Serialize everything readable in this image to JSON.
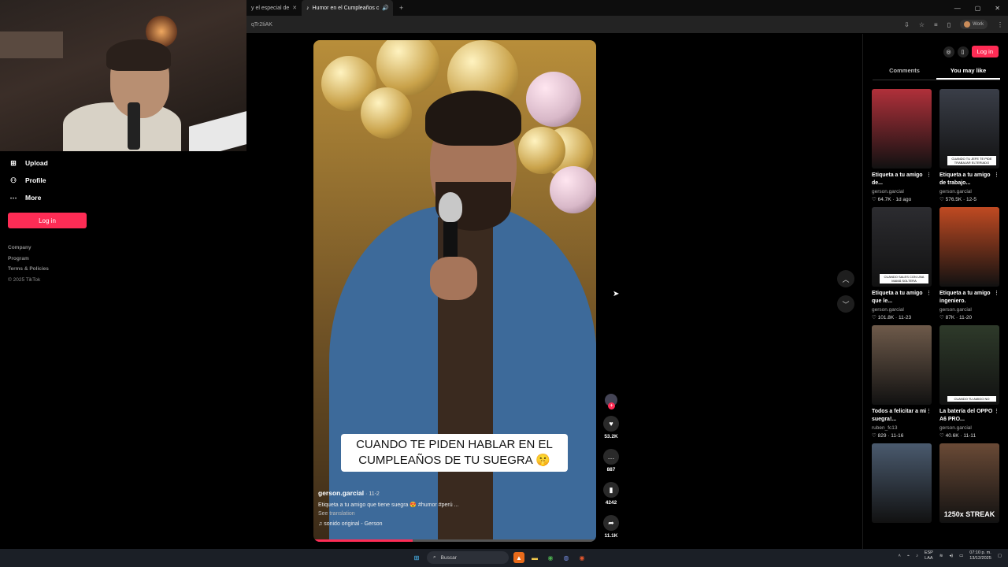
{
  "browser": {
    "tabs": [
      {
        "title": "y el especial de"
      },
      {
        "title": "Humor en el Cumpleaños c"
      }
    ],
    "url_fragment": "qTr2IiAK",
    "profile_label": "Work"
  },
  "leftnav": {
    "items": [
      {
        "label": "Upload"
      },
      {
        "label": "Profile"
      },
      {
        "label": "More"
      }
    ],
    "login_label": "Log in",
    "footer": [
      "Company",
      "Program",
      "Terms & Policies"
    ],
    "copyright": "© 2025 TikTok"
  },
  "video": {
    "caption_line1": "CUANDO TE PIDEN HABLAR EN EL",
    "caption_line2": "CUMPLEAÑOS DE TU SUEGRA 🤫",
    "author": "gerson.garcial",
    "date": "· 11-2",
    "description": "Etiqueta a tu amigo que tiene suegra 😍 #humor #perú ...",
    "see_translation": "See translation",
    "sound": "sonido original - Gerson",
    "progress": 0.35
  },
  "actions": {
    "likes": "53.2K",
    "comments": "887",
    "saves": "4242",
    "shares": "11.1K"
  },
  "rightpanel": {
    "login_label": "Log in",
    "tabs": [
      "Comments",
      "You may like"
    ],
    "cards": [
      {
        "title": "Etiqueta a tu amigo de...",
        "user": "gerson.garcial",
        "stats": "♡ 64.7K · 1d ago",
        "overlay": "",
        "bg": "#b0303a"
      },
      {
        "title": "Etiqueta a tu amigo de trabajo...",
        "user": "gerson.garcial",
        "stats": "♡ 576.5K · 12-5",
        "overlay": "CUANDO TU JEFE TE PIDE TRABAJAR ELTERIADO",
        "bg": "#3a3e48"
      },
      {
        "title": "Etiqueta a tu amigo que le...",
        "user": "gerson.garcial",
        "stats": "♡ 101.8K · 11-23",
        "overlay": "CUANDO SALES CON UNA MAMÁ SOLTERA",
        "bg": "#2c2c30"
      },
      {
        "title": "Etiqueta a tu amigo ingeniero.",
        "user": "gerson.garcial",
        "stats": "♡ 87K · 11-20",
        "overlay": "",
        "bg": "#c04a22"
      },
      {
        "title": "Todos a felicitar a mi suegra!...",
        "user": "ruben_fc13",
        "stats": "♡ 829 · 11-16",
        "overlay": "",
        "bg": "#6e5a4a"
      },
      {
        "title": "La batería del OPPO A6 PRO...",
        "user": "gerson.garcial",
        "stats": "♡ 40.6K · 11-11",
        "overlay": "CUANDO TU AMIGO NO",
        "bg": "#2e3a2a"
      },
      {
        "title": "",
        "user": "",
        "stats": "",
        "overlay": "",
        "bg": "#4a5a6e"
      },
      {
        "title": "",
        "user": "",
        "stats": "",
        "overlay": "1250x STREAK",
        "bg": "#6a4a36"
      }
    ]
  },
  "taskbar": {
    "search_label": "Buscar",
    "lang1": "ESP",
    "lang2": "LAA",
    "time": "07:10 p. m.",
    "date": "13/12/2025"
  },
  "colors": {
    "accent": "#fe2c55",
    "background": "#000000",
    "taskbar": "#1b1f26"
  }
}
